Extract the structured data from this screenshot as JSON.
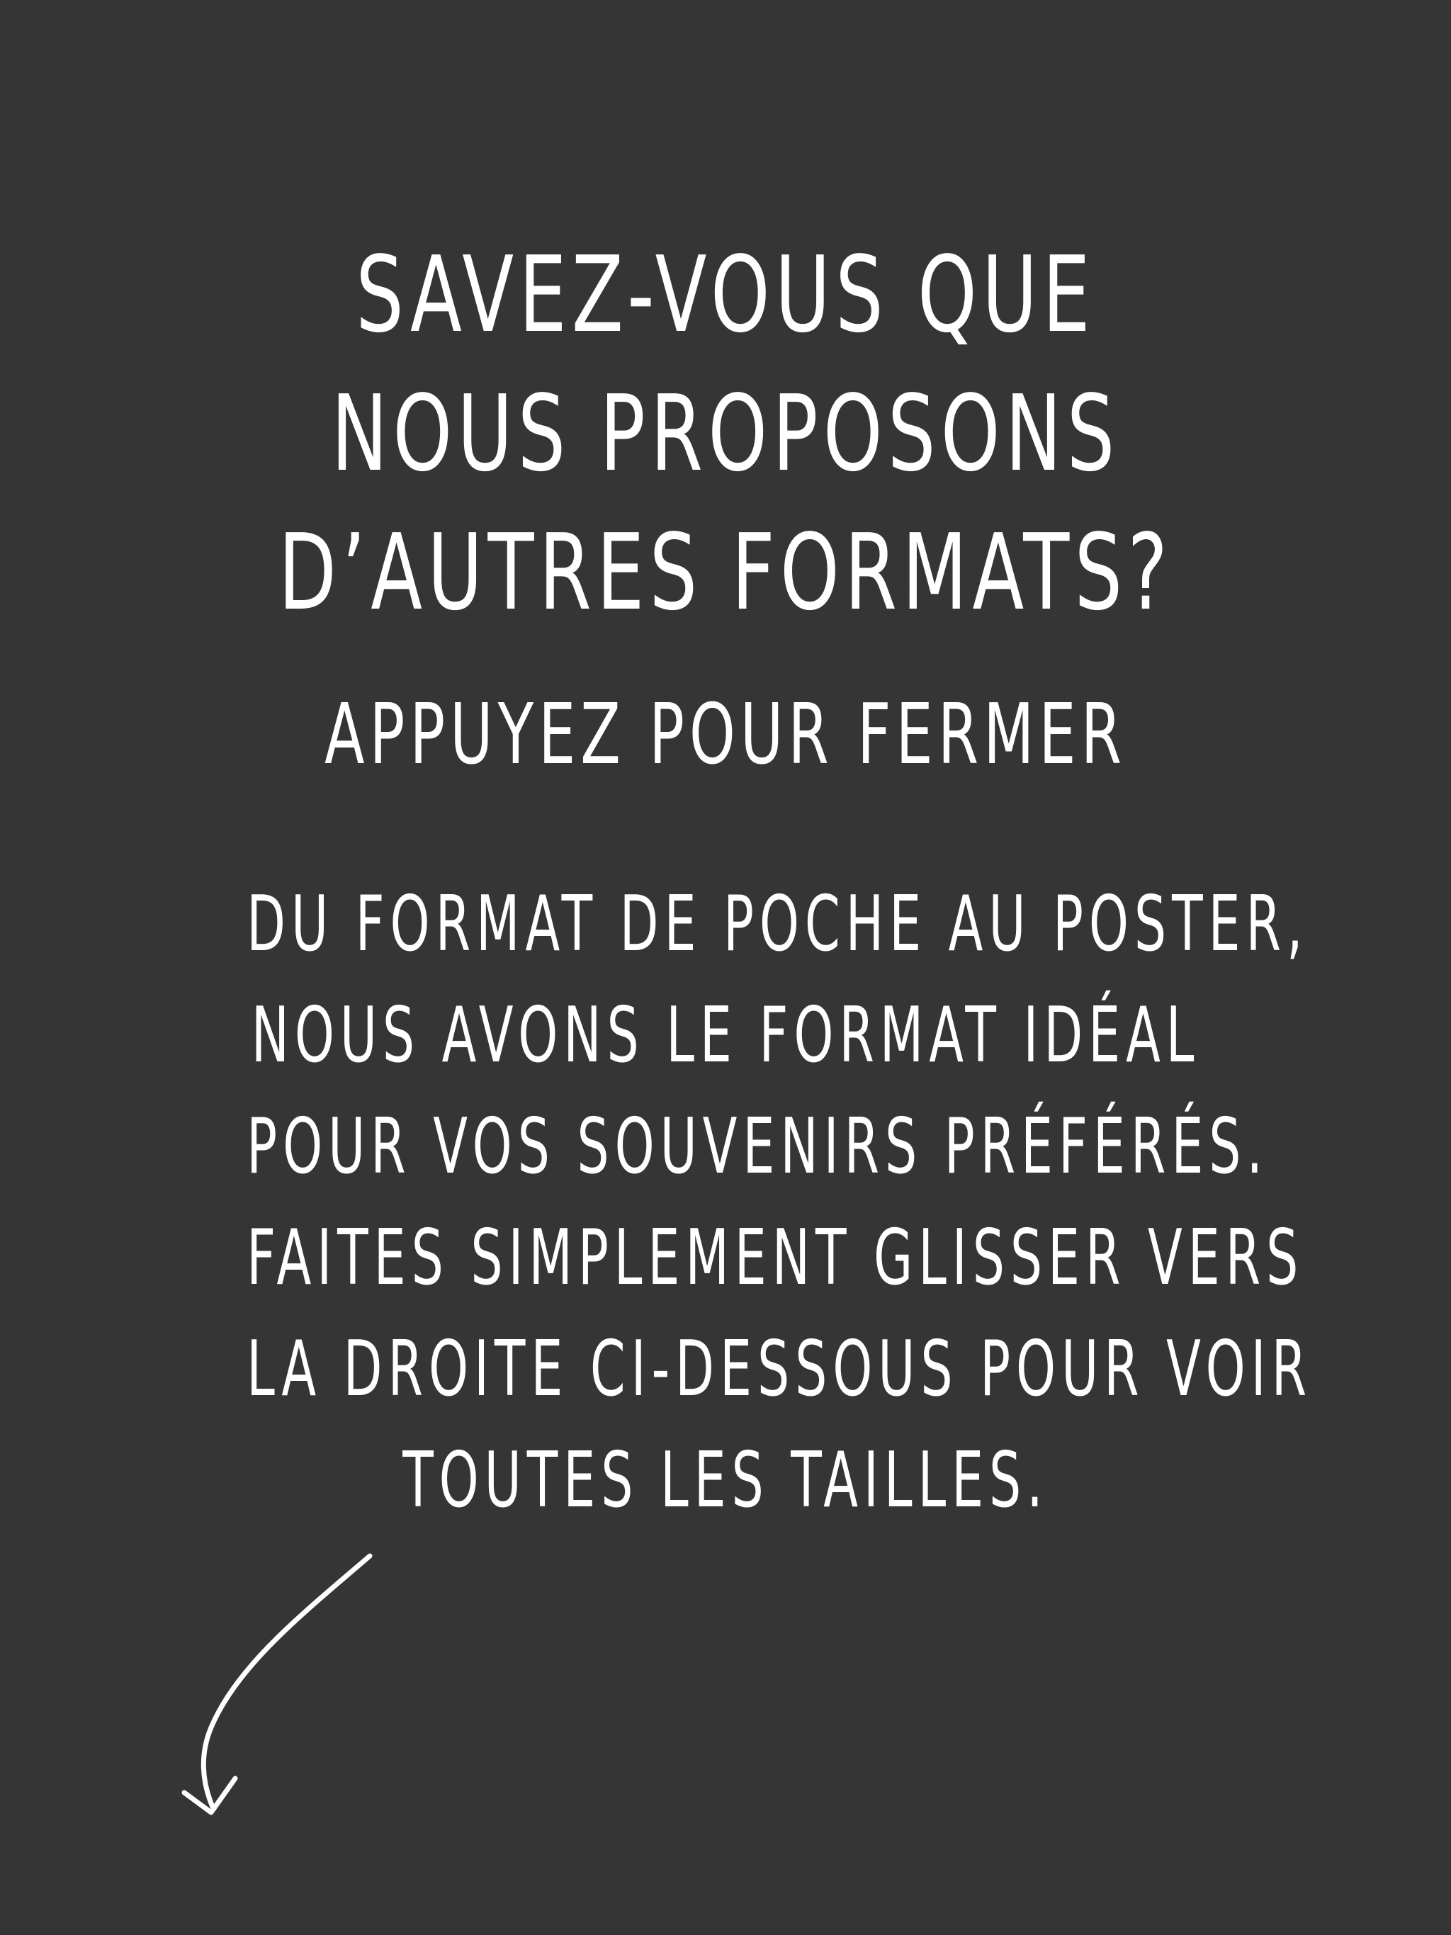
{
  "colors": {
    "background": "#353535",
    "text": "#ffffff"
  },
  "modal": {
    "title_lines": [
      "SAVEZ-VOUS QUE",
      "NOUS PROPOSONS",
      "D’AUTRES FORMATS?"
    ],
    "close_label": "APPUYEZ POUR FERMER",
    "body_lines": [
      "DU FORMAT DE POCHE AU POSTER,",
      "NOUS AVONS LE FORMAT IDÉAL",
      "POUR VOS SOUVENIRS PRÉFÉRÉS.",
      "FAITES SIMPLEMENT GLISSER VERS",
      "LA DROITE CI-DESSOUS POUR VOIR",
      "TOUTES LES TAILLES."
    ],
    "arrow_icon": "curved-arrow-down-left"
  }
}
